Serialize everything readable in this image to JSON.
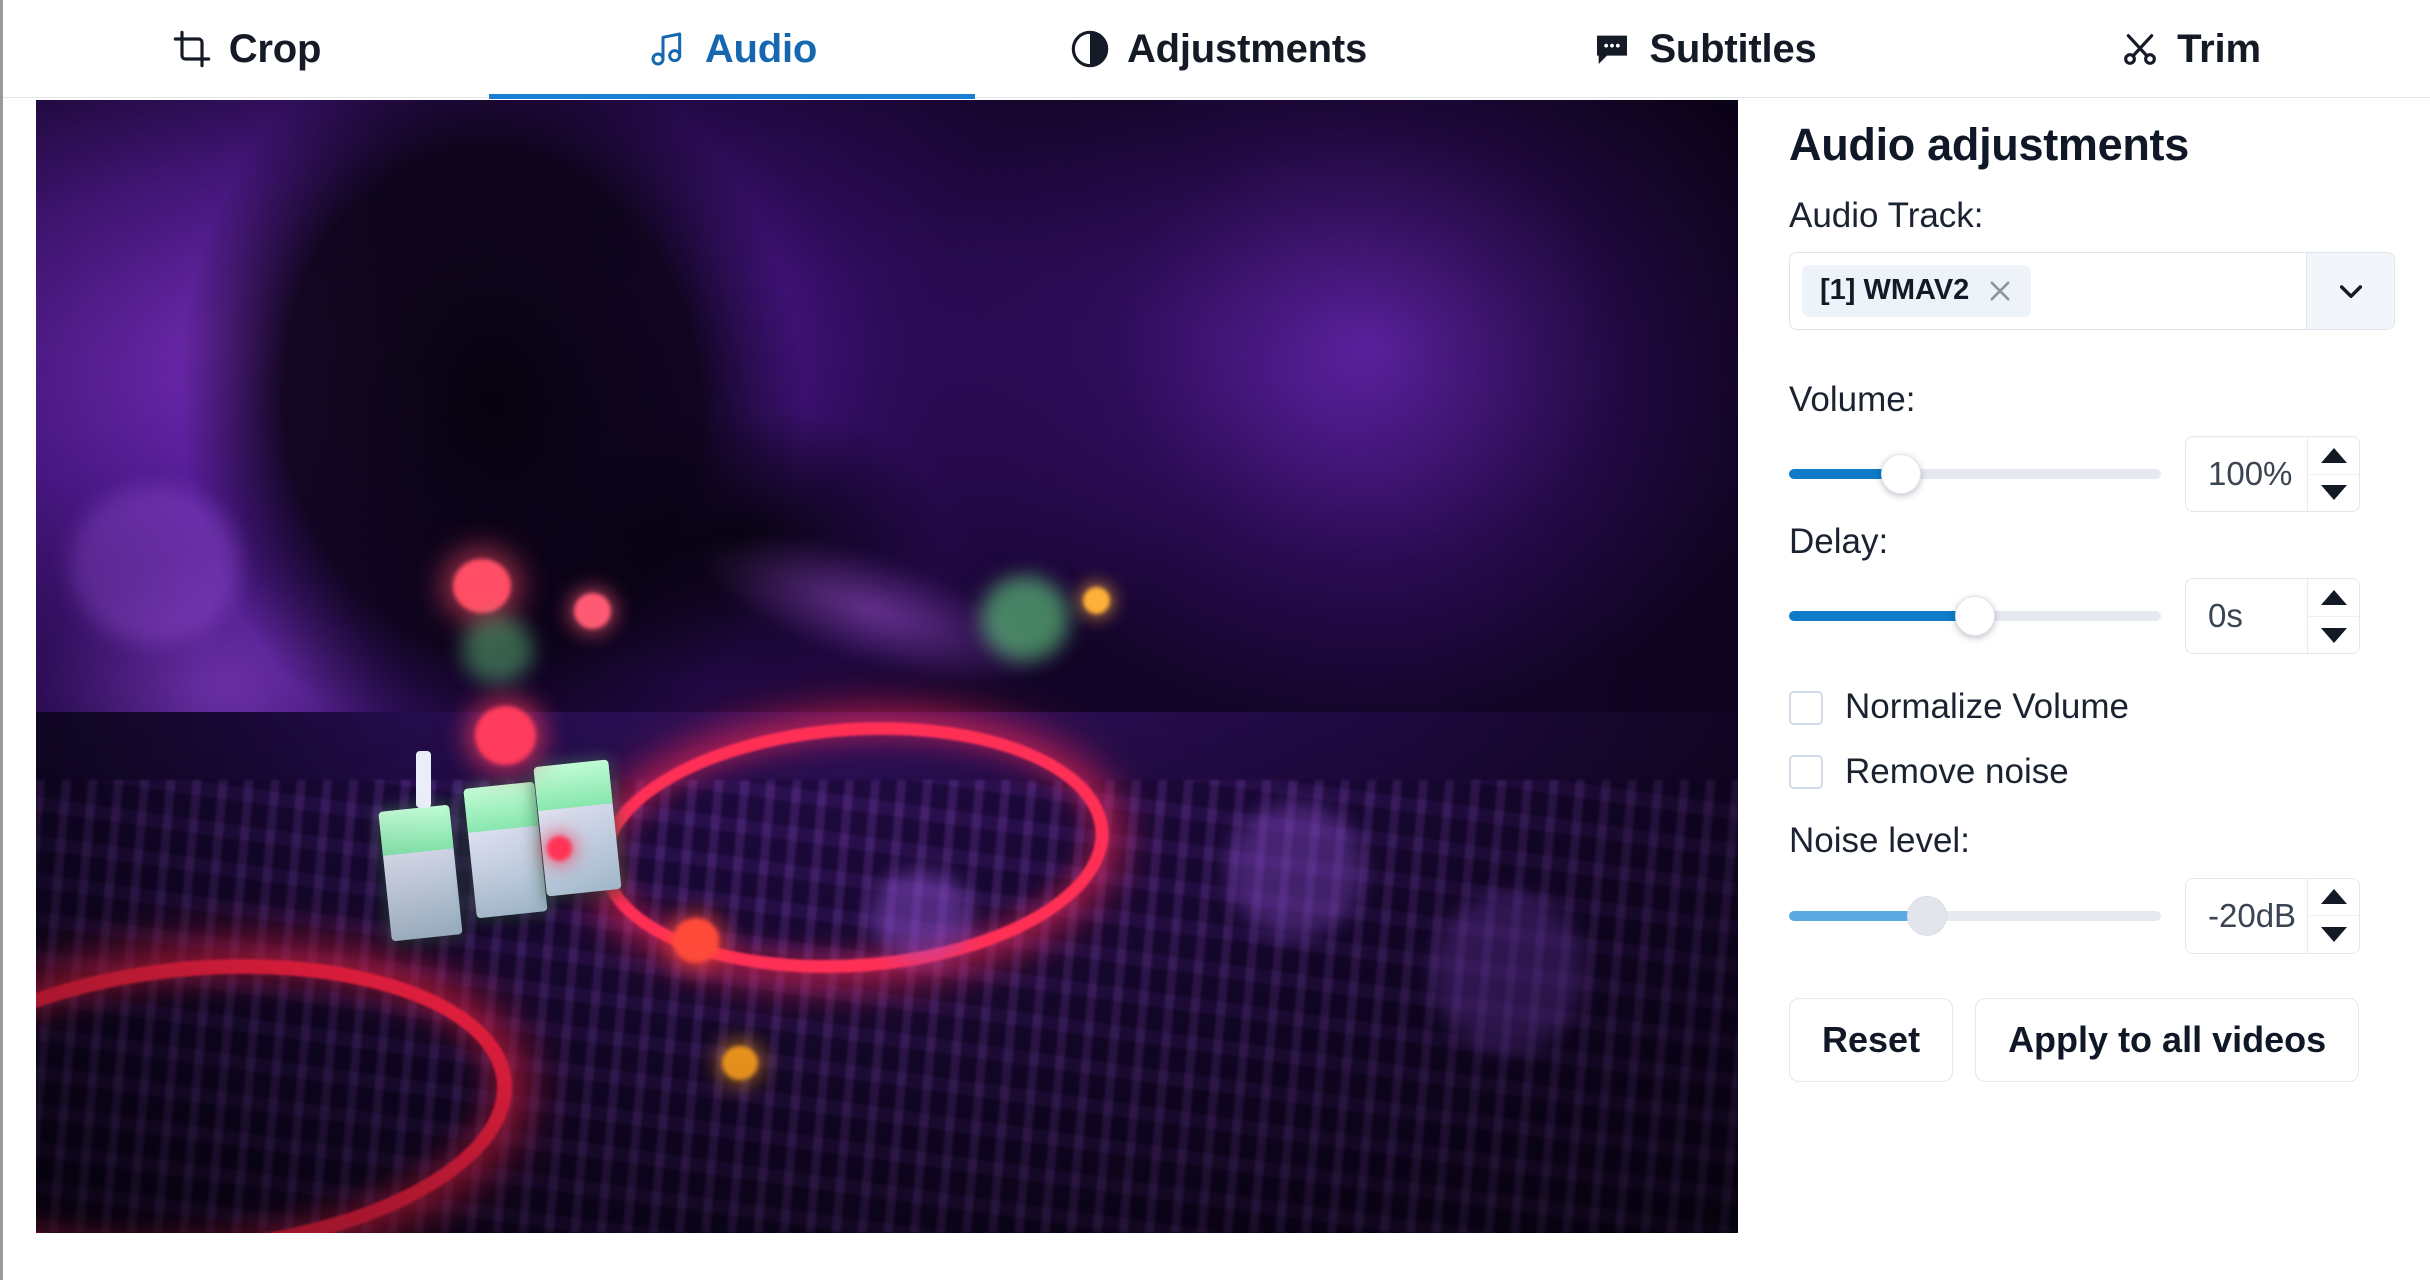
{
  "tabs": [
    {
      "id": "crop",
      "label": "Crop",
      "icon": "crop-icon",
      "active": false
    },
    {
      "id": "audio",
      "label": "Audio",
      "icon": "music-note-icon",
      "active": true
    },
    {
      "id": "adjustments",
      "label": "Adjustments",
      "icon": "contrast-circle-icon",
      "active": false
    },
    {
      "id": "subtitles",
      "label": "Subtitles",
      "icon": "speech-bubble-icon",
      "active": false
    },
    {
      "id": "trim",
      "label": "Trim",
      "icon": "scissors-icon",
      "active": false
    }
  ],
  "preview": {
    "alt": "Video preview of a DJ controller with purple and red neon lighting"
  },
  "panel": {
    "title": "Audio adjustments",
    "audio_track": {
      "label": "Audio Track:",
      "selected_chips": [
        {
          "label": "[1] WMAV2",
          "remove_icon": "close-icon"
        }
      ],
      "caret_icon": "chevron-down-icon"
    },
    "volume": {
      "label": "Volume:",
      "value": "100%",
      "slider_percent": 30,
      "disabled": false
    },
    "delay": {
      "label": "Delay:",
      "value": "0s",
      "slider_percent": 50,
      "disabled": false
    },
    "checkboxes": [
      {
        "id": "normalize-volume",
        "label": "Normalize Volume",
        "checked": false
      },
      {
        "id": "remove-noise",
        "label": "Remove noise",
        "checked": false
      }
    ],
    "noise_level": {
      "label": "Noise level:",
      "value": "-20dB",
      "slider_percent": 37,
      "disabled": true
    },
    "buttons": [
      {
        "id": "reset",
        "label": "Reset"
      },
      {
        "id": "apply-all",
        "label": "Apply to all videos"
      }
    ]
  },
  "colors": {
    "accent": "#1a7fd4",
    "active_tab_text": "#1568b0",
    "slider_fill": "#0f7ac8",
    "slider_fill_disabled": "#5aa9e0",
    "text": "#101727"
  }
}
